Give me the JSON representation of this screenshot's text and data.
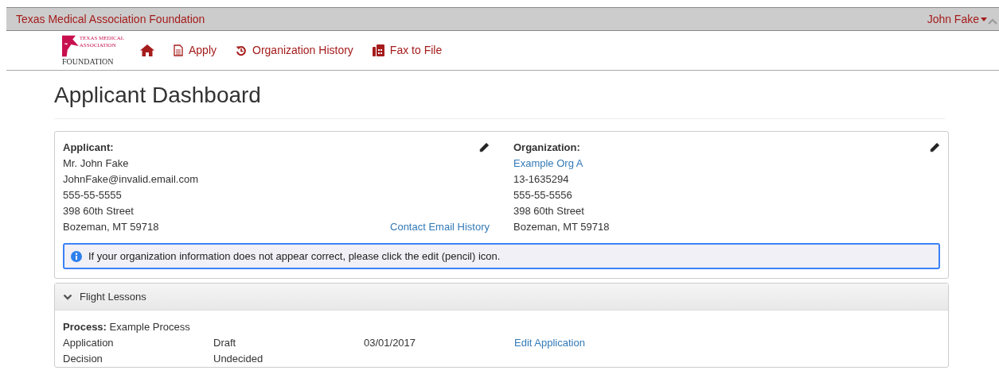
{
  "top_bar": {
    "title": "Texas Medical Association Foundation",
    "user_menu": "John Fake"
  },
  "logo": {
    "lines": [
      "TEXAS MEDICAL",
      "ASSOCIATION"
    ],
    "foundation": "FOUNDATION"
  },
  "nav": [
    {
      "kind": "home"
    },
    {
      "kind": "apply",
      "label": "Apply"
    },
    {
      "kind": "history",
      "label": "Organization History"
    },
    {
      "kind": "fax",
      "label": "Fax to File"
    }
  ],
  "page_title": "Applicant Dashboard",
  "applicant": {
    "heading": "Applicant:",
    "lines": [
      "Mr. John Fake",
      "JohnFake@invalid.email.com",
      "555-55-5555",
      "398 60th Street",
      "Bozeman, MT 59718"
    ],
    "link": "Contact Email History"
  },
  "organization": {
    "heading": "Organization:",
    "name": "Example Org A",
    "lines": [
      "13-1635294",
      "555-55-5556",
      "398 60th Street",
      "Bozeman, MT 59718"
    ]
  },
  "info_alert": "If your organization information does not appear correct, please click the edit (pencil) icon.",
  "program": {
    "title": "Flight Lessons",
    "expanded": true,
    "process_label": "Process:",
    "process": "Example Process",
    "rows": [
      {
        "step": "Application",
        "status": "Draft",
        "date": "03/01/2017",
        "action": "Edit Application"
      },
      {
        "step": "Decision",
        "status": "Undecided"
      }
    ]
  }
}
